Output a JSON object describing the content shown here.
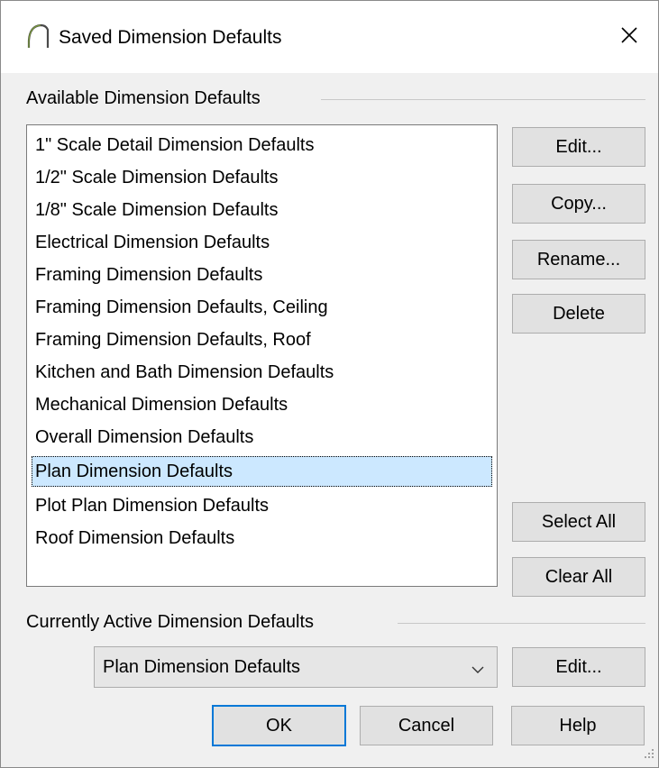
{
  "window": {
    "title": "Saved Dimension Defaults",
    "close_icon": "close-icon",
    "app_icon": "arc-icon"
  },
  "available": {
    "group_label": "Available Dimension Defaults",
    "items": [
      "1\" Scale Detail Dimension Defaults",
      "1/2\" Scale Dimension Defaults",
      "1/8\" Scale Dimension Defaults",
      "Electrical Dimension Defaults",
      "Framing Dimension Defaults",
      "Framing Dimension Defaults, Ceiling",
      "Framing Dimension Defaults, Roof",
      "Kitchen and Bath Dimension Defaults",
      "Mechanical Dimension Defaults",
      "Overall Dimension Defaults",
      "Plan Dimension Defaults",
      "Plot Plan Dimension Defaults",
      "Roof Dimension Defaults"
    ],
    "selected_item": "Plan Dimension Defaults"
  },
  "side_buttons": {
    "edit": "Edit...",
    "copy": "Copy...",
    "rename": "Rename...",
    "delete": "Delete",
    "select_all": "Select All",
    "clear_all": "Clear All"
  },
  "active": {
    "group_label": "Currently Active Dimension Defaults",
    "selected_value": "Plan Dimension Defaults",
    "edit": "Edit..."
  },
  "footer": {
    "ok": "OK",
    "cancel": "Cancel",
    "help": "Help"
  },
  "colors": {
    "selection": "#cce8ff",
    "default_button_border": "#0078d7",
    "dialog_background": "#f0f0f0"
  }
}
